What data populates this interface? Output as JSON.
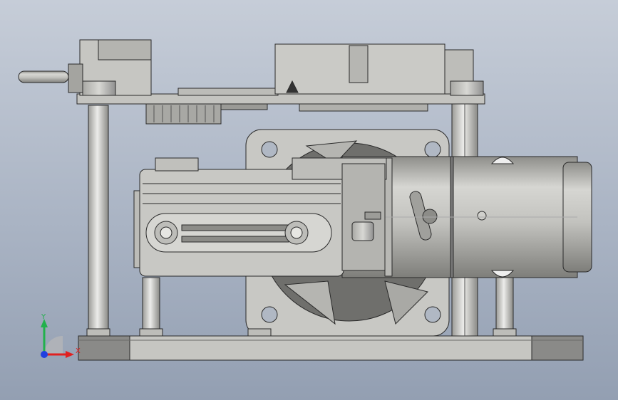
{
  "viewport": {
    "background_top": "#c6cdd8",
    "background_bottom": "#939fb2"
  },
  "triad": {
    "y_label": "Y",
    "x_label": "X",
    "y_color": "#22b14c",
    "x_color": "#e02020",
    "z_color": "#2040e0"
  },
  "model": {
    "body_color": "#c8c8c4",
    "shade_color": "#9e9e9a",
    "edge_color": "#2a2a2a",
    "dark_block_color": "#8a8a88"
  }
}
